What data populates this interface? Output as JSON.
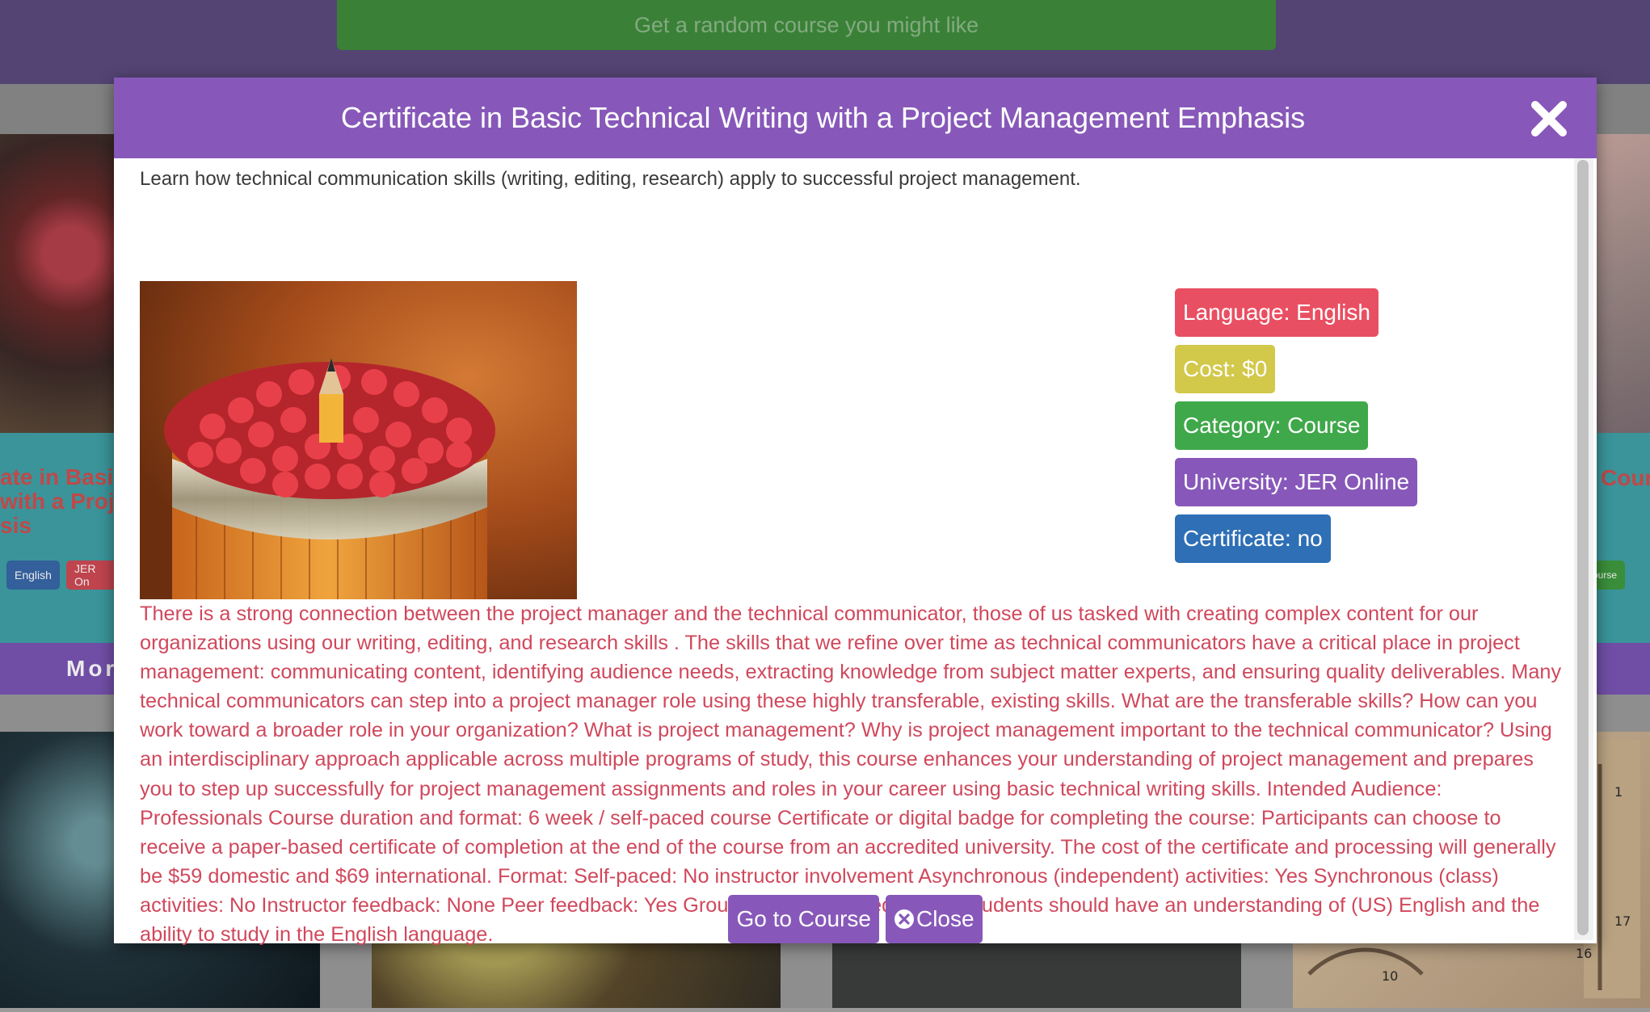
{
  "background": {
    "random_button": "Get a random course you might like",
    "left_card": {
      "title_lines": [
        "ate in Basic",
        " with a Proj",
        "sis"
      ],
      "chips": [
        {
          "label": "English",
          "color": "#3868a8"
        },
        {
          "label": "JER On",
          "color": "#d04a55"
        }
      ],
      "more_label": "Mor"
    },
    "right_card": {
      "title": "Cour",
      "chips": [
        {
          "label": "ourse",
          "color": "#3f9b3f"
        }
      ]
    }
  },
  "modal": {
    "title": "Certificate in Basic Technical Writing with a Project Management Emphasis",
    "subtitle": "Learn how technical communication skills (writing, editing, research) apply to successful project management.",
    "badges": [
      {
        "label": "Language: English",
        "color": "#e94f62"
      },
      {
        "label": "Cost: $0",
        "color": "#d2c84a"
      },
      {
        "label": "Category: Course",
        "color": "#3fa84a"
      },
      {
        "label": "University: JER Online",
        "color": "#8758b9"
      },
      {
        "label": "Certificate: no",
        "color": "#2e6fb5"
      }
    ],
    "description": "There is a strong connection between the project manager and the technical communicator, those of us tasked with creating complex content for our organizations using our writing, editing, and research skills . The skills that we refine over time as technical communicators have a critical place in project management: communicating content, identifying audience needs, extracting knowledge from subject matter experts, and ensuring quality deliverables. Many technical communicators can step into a project manager role using these highly transferable, existing skills. What are the transferable skills? How can you work toward a broader role in your organization? What is project management? Why is project management important to the technical communicator? Using an interdisciplinary approach applicable across multiple programs of study, this course enhances your understanding of project management and prepares you to step up successfully for project management assignments and roles in your career using basic technical writing skills. Intended Audience: Professionals Course duration and format: 6 week / self-paced course Certificate or digital badge for completing the course: Participants can choose to receive a paper-based certificate of completion at the end of the course from an accredited university. The cost of the certificate and processing will generally be $59 domestic and $69 international. Format: Self-paced: No instructor involvement Asynchronous (independent) activities: Yes Synchronous (class) activities: No Instructor feedback: None Peer feedback: Yes Group work: No Prerequisites: Students should have an understanding of (US) English and the ability to study in the English language.",
    "go_button": "Go to Course",
    "close_button": "Close",
    "accent": "#8758b9"
  },
  "icons": {
    "close": "close-x-icon",
    "close_circle": "x-circle-icon"
  }
}
